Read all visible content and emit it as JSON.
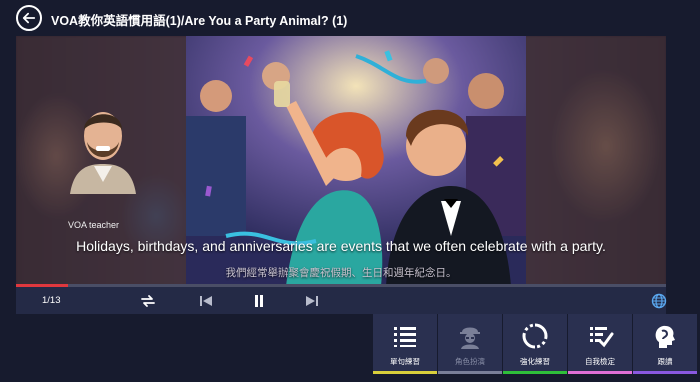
{
  "header": {
    "title": "VOA教你英語慣用語(1)/Are You a Party Animal? (1)",
    "back_icon": "back-arrow-icon"
  },
  "video": {
    "teacher_label": "VOA teacher",
    "subtitle_en": "Holidays, birthdays, and anniversaries are events that we often celebrate with a party.",
    "subtitle_zh": "我們經常舉辦聚會慶祝假期、生日和週年紀念日。"
  },
  "player": {
    "counter": "1/13",
    "progress_fraction": 0.08,
    "progress_color": "#e0383e",
    "icons": [
      "repeat-icon",
      "previous-icon",
      "pause-icon",
      "next-icon",
      "globe-icon"
    ]
  },
  "tools": [
    {
      "label": "單句練習",
      "icon": "list-icon",
      "color": "#d9cf3b",
      "enabled": true
    },
    {
      "label": "角色扮演",
      "icon": "role-play-icon",
      "color": "#7a7f98",
      "enabled": false
    },
    {
      "label": "強化練習",
      "icon": "refresh-icon",
      "color": "#2fbf3a",
      "enabled": true
    },
    {
      "label": "自我檢定",
      "icon": "checklist-icon",
      "color": "#e06fd6",
      "enabled": true
    },
    {
      "label": "跟讀",
      "icon": "speaking-head-icon",
      "color": "#8a58e0",
      "enabled": true
    }
  ]
}
